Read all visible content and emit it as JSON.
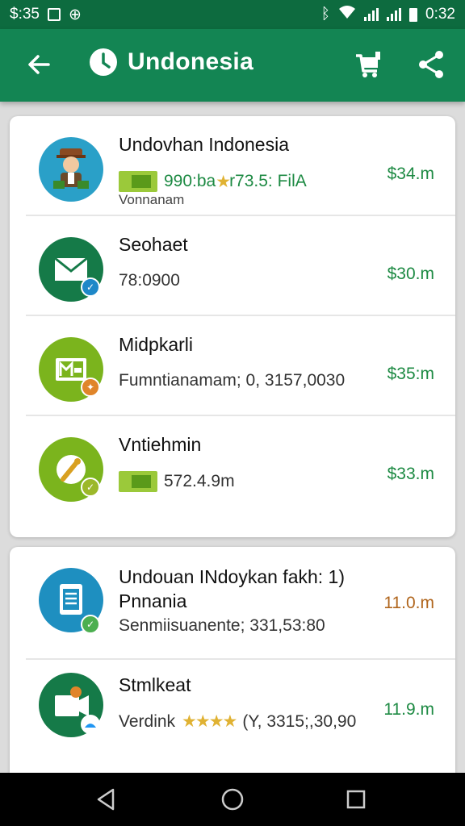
{
  "status_bar": {
    "time_left": "$:35",
    "time_right": "0:32"
  },
  "app_bar": {
    "title": "Undonesia",
    "icons": [
      "back-arrow-icon",
      "clock-icon",
      "cart-icon",
      "share-icon"
    ]
  },
  "card1": {
    "items": [
      {
        "title": "Undovhan Indonesia",
        "sub_prefix": "990:ba",
        "sub_stars": "★",
        "sub_rest": "r73.5: FilA",
        "third": "Vonnanam",
        "price": "$34.m",
        "avatar_color": "#2aa0c8",
        "icon": "person-icon"
      },
      {
        "title": "Seohaet",
        "sub": "78:0900",
        "price": "$30.m",
        "avatar_color": "#157a48",
        "icon": "mail-icon",
        "badge_color": "#1e88c8"
      },
      {
        "title": "Midpkarli",
        "sub": "Fumntianamam; 0, 3157,0030",
        "price": "$35:m",
        "avatar_color": "#7bb41d",
        "icon": "image-icon",
        "badge_color": "#e0852a"
      },
      {
        "title": "Vntiehmin",
        "sub": "572.4.9m",
        "price": "$33.m",
        "avatar_color": "#7bb41d",
        "icon": "tag-icon",
        "badge_color": "#9cb82a"
      }
    ]
  },
  "card2": {
    "items": [
      {
        "title": "Undouan INdoykan fakh: 1)",
        "title2": "Pnnania",
        "sub": "Senmiisuanente; 331,53:80",
        "price": "11.0.m",
        "avatar_color": "#1e8fc0",
        "icon": "document-icon",
        "badge_color": "#4caf50"
      },
      {
        "title": "Stmlkeat",
        "sub_prefix": "Verdink",
        "sub_stars": "★★★★",
        "sub_rest": "(Y, 3315;,30,90",
        "price": "11.9.m",
        "avatar_color": "#157a48",
        "icon": "video-icon",
        "badge_color": "#2196f3"
      }
    ]
  }
}
